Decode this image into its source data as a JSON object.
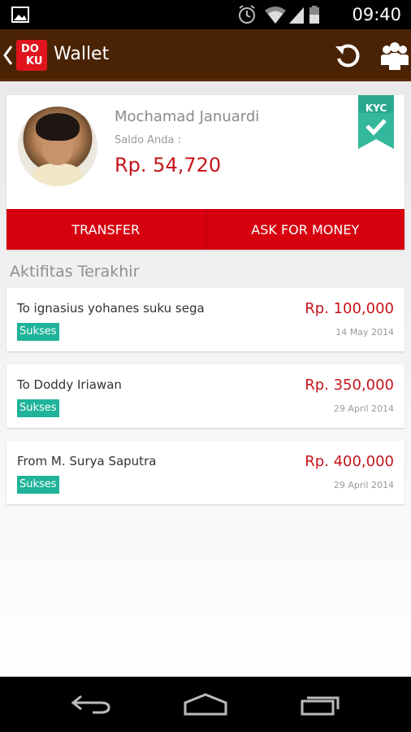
{
  "status_bar": {
    "time": "09:40"
  },
  "app_bar": {
    "title": "Wallet",
    "logo_top": "DO",
    "logo_bottom": "KU"
  },
  "profile": {
    "name": "Mochamad Januardi",
    "saldo_label": "Saldo Anda :",
    "saldo_value": "Rp. 54,720",
    "kyc_label": "KYC"
  },
  "actions": {
    "transfer": "TRANSFER",
    "ask": "ASK FOR MONEY"
  },
  "section_title": "Aktifitas Terakhir",
  "activities": [
    {
      "description": "To ignasius yohanes suku sega",
      "status": "Sukses",
      "amount": "Rp. 100,000",
      "date": "14 May 2014"
    },
    {
      "description": "To Doddy Iriawan",
      "status": "Sukses",
      "amount": "Rp. 350,000",
      "date": "29 April 2014"
    },
    {
      "description": "From M. Surya Saputra",
      "status": "Sukses",
      "amount": "Rp. 400,000",
      "date": "29 April 2014"
    }
  ],
  "colors": {
    "app_bar": "#4a2304",
    "accent_red": "#d7000f",
    "amount_red": "#c4161c",
    "success_green": "#1fb39a",
    "kyc_green": "#2aa98f"
  },
  "icons": [
    "gallery-icon",
    "alarm-icon",
    "wifi-icon",
    "signal-icon",
    "battery-icon",
    "back-chevron-icon",
    "refresh-icon",
    "group-icon",
    "kyc-check-icon",
    "nav-back-icon",
    "nav-home-icon",
    "nav-recents-icon"
  ]
}
